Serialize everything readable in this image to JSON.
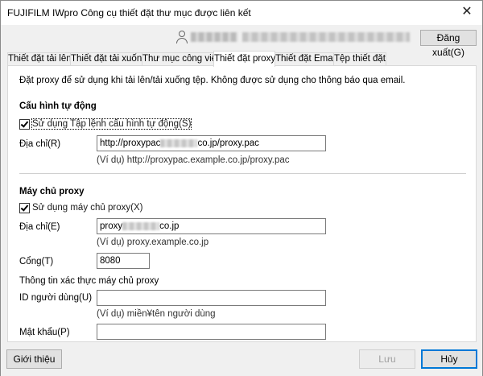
{
  "window": {
    "title": "FUJIFILM IWpro Công cụ thiết đặt thư mục được liên kết",
    "close_glyph": "✕"
  },
  "header": {
    "logout_label": "Đăng xuất(G)"
  },
  "tabs": [
    {
      "label": "Thiết đặt tải lên",
      "active": false
    },
    {
      "label": "Thiết đặt tải xuống",
      "active": false
    },
    {
      "label": "Thư mục công việc",
      "active": false
    },
    {
      "label": "Thiết đặt proxy",
      "active": true
    },
    {
      "label": "Thiết đặt Email",
      "active": false
    },
    {
      "label": "Tệp thiết đặt",
      "active": false
    }
  ],
  "proxy": {
    "description": "Đặt proxy để sử dụng khi tải lên/tải xuống tệp. Không được sử dụng cho thông báo qua email.",
    "auto": {
      "heading": "Cấu hình tự động",
      "use_script_label": "Sử dụng Tập lệnh cấu hình tự động(S)",
      "use_script_checked": true,
      "address_label": "Địa chỉ(R)",
      "address_value_prefix": "http://proxypac",
      "address_value_suffix": "co.jp/proxy.pac",
      "address_example": "(Ví dụ) http://proxypac.example.co.jp/proxy.pac"
    },
    "server": {
      "heading": "Máy chủ proxy",
      "use_server_label": "Sử dụng máy chủ proxy(X)",
      "use_server_checked": true,
      "address_label": "Địa chỉ(E)",
      "address_value_prefix": "proxy",
      "address_value_suffix": "co.jp",
      "address_example": "(Ví dụ) proxy.example.co.jp",
      "port_label": "Cổng(T)",
      "port_value": "8080",
      "auth_heading": "Thông tin xác thực máy chủ proxy",
      "user_id_label": "ID người dùng(U)",
      "user_id_value": "",
      "user_id_example": "(Ví dụ) miền¥tên người dùng",
      "password_label": "Mật khẩu(P)",
      "password_value": ""
    }
  },
  "footer": {
    "about_label": "Giới thiệu",
    "save_label": "Lưu",
    "cancel_label": "Hủy"
  }
}
